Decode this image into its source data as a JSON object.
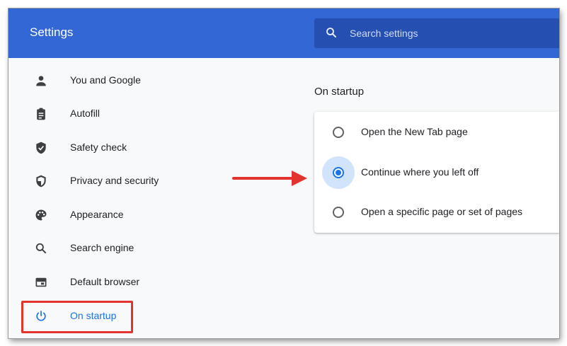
{
  "header": {
    "title": "Settings",
    "search": {
      "placeholder": "Search settings",
      "value": ""
    }
  },
  "sidebar": {
    "items": [
      {
        "label": "You and Google",
        "icon": "person-icon"
      },
      {
        "label": "Autofill",
        "icon": "clipboard-icon"
      },
      {
        "label": "Safety check",
        "icon": "shield-check-icon"
      },
      {
        "label": "Privacy and security",
        "icon": "shield-icon"
      },
      {
        "label": "Appearance",
        "icon": "palette-icon"
      },
      {
        "label": "Search engine",
        "icon": "search-icon"
      },
      {
        "label": "Default browser",
        "icon": "browser-window-icon"
      },
      {
        "label": "On startup",
        "icon": "power-icon",
        "active": true
      }
    ]
  },
  "main": {
    "section_title": "On startup",
    "options": [
      {
        "label": "Open the New Tab page",
        "selected": false
      },
      {
        "label": "Continue where you left off",
        "selected": true
      },
      {
        "label": "Open a specific page or set of pages",
        "selected": false
      }
    ]
  },
  "colors": {
    "header_bg": "#3367d6",
    "search_bg": "#254fb0",
    "accent": "#1a73e8",
    "annotation": "#e2332e"
  }
}
